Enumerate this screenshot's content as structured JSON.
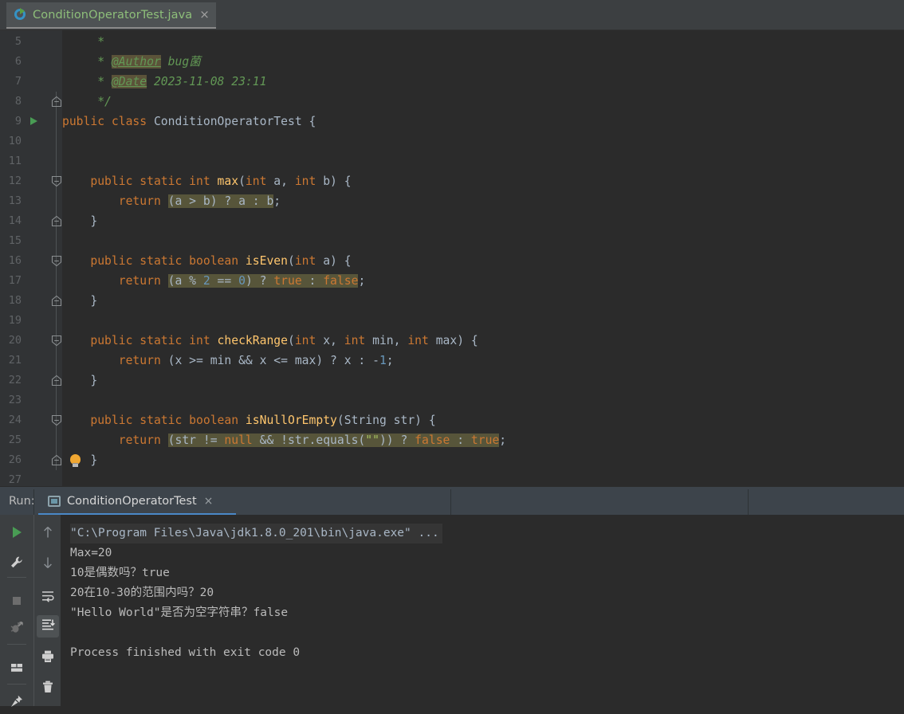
{
  "editor_tab": {
    "title": "ConditionOperatorTest.java",
    "icon": "java-class-runnable-icon",
    "close_label": "×"
  },
  "editor": {
    "first_visible_line": 5,
    "last_visible_line": 27,
    "lines": [
      {
        "n": 5,
        "fold": null,
        "run": false,
        "bulb": false,
        "tokens": [
          {
            "t": "     *",
            "c": "cmt"
          }
        ]
      },
      {
        "n": 6,
        "fold": null,
        "run": false,
        "bulb": false,
        "tokens": [
          {
            "t": "     * ",
            "c": "cmt"
          },
          {
            "t": "@Author",
            "c": "tagh"
          },
          {
            "t": " bug菌",
            "c": "cmt"
          }
        ]
      },
      {
        "n": 7,
        "fold": null,
        "run": false,
        "bulb": false,
        "tokens": [
          {
            "t": "     * ",
            "c": "cmt"
          },
          {
            "t": "@Date",
            "c": "tagh"
          },
          {
            "t": " 2023-11-08 23:11",
            "c": "cmt"
          }
        ]
      },
      {
        "n": 8,
        "fold": "end",
        "run": false,
        "bulb": false,
        "tokens": [
          {
            "t": "     */",
            "c": "cmt"
          }
        ]
      },
      {
        "n": 9,
        "fold": null,
        "run": true,
        "bulb": false,
        "tokens": [
          {
            "t": "public ",
            "c": "kw"
          },
          {
            "t": "class ",
            "c": "kw"
          },
          {
            "t": "ConditionOperatorTest",
            "c": "plain"
          },
          {
            "t": " {",
            "c": "plain"
          }
        ]
      },
      {
        "n": 10,
        "fold": null,
        "run": false,
        "bulb": false,
        "tokens": []
      },
      {
        "n": 11,
        "fold": null,
        "run": false,
        "bulb": false,
        "tokens": []
      },
      {
        "n": 12,
        "fold": "start",
        "run": false,
        "bulb": false,
        "tokens": [
          {
            "t": "    ",
            "c": "plain"
          },
          {
            "t": "public static int ",
            "c": "kw"
          },
          {
            "t": "max",
            "c": "meth"
          },
          {
            "t": "(",
            "c": "plain"
          },
          {
            "t": "int ",
            "c": "kw"
          },
          {
            "t": "a, ",
            "c": "plain"
          },
          {
            "t": "int ",
            "c": "kw"
          },
          {
            "t": "b) {",
            "c": "plain"
          }
        ]
      },
      {
        "n": 13,
        "fold": "bar",
        "run": false,
        "bulb": false,
        "tokens": [
          {
            "t": "        ",
            "c": "plain"
          },
          {
            "t": "return ",
            "c": "kw"
          },
          {
            "t": "(a > b) ? a : b",
            "c": "plain",
            "hl": true
          },
          {
            "t": ";",
            "c": "plain"
          }
        ]
      },
      {
        "n": 14,
        "fold": "end",
        "run": false,
        "bulb": false,
        "tokens": [
          {
            "t": "    }",
            "c": "plain"
          }
        ]
      },
      {
        "n": 15,
        "fold": null,
        "run": false,
        "bulb": false,
        "tokens": []
      },
      {
        "n": 16,
        "fold": "start",
        "run": false,
        "bulb": false,
        "tokens": [
          {
            "t": "    ",
            "c": "plain"
          },
          {
            "t": "public static boolean ",
            "c": "kw"
          },
          {
            "t": "isEven",
            "c": "meth"
          },
          {
            "t": "(",
            "c": "plain"
          },
          {
            "t": "int ",
            "c": "kw"
          },
          {
            "t": "a) {",
            "c": "plain"
          }
        ]
      },
      {
        "n": 17,
        "fold": "bar",
        "run": false,
        "bulb": false,
        "tokens": [
          {
            "t": "        ",
            "c": "plain"
          },
          {
            "t": "return ",
            "c": "kw"
          },
          {
            "t": "(a % ",
            "c": "plain",
            "hl": true
          },
          {
            "t": "2",
            "c": "num",
            "hl": true
          },
          {
            "t": " == ",
            "c": "plain",
            "hl": true
          },
          {
            "t": "0",
            "c": "num",
            "hl": true
          },
          {
            "t": ") ? ",
            "c": "plain",
            "hl": true
          },
          {
            "t": "true",
            "c": "kw",
            "hl": true
          },
          {
            "t": " : ",
            "c": "plain",
            "hl": true
          },
          {
            "t": "false",
            "c": "kw",
            "hl": true
          },
          {
            "t": ";",
            "c": "plain"
          }
        ]
      },
      {
        "n": 18,
        "fold": "end",
        "run": false,
        "bulb": false,
        "tokens": [
          {
            "t": "    }",
            "c": "plain"
          }
        ]
      },
      {
        "n": 19,
        "fold": null,
        "run": false,
        "bulb": false,
        "tokens": []
      },
      {
        "n": 20,
        "fold": "start",
        "run": false,
        "bulb": false,
        "tokens": [
          {
            "t": "    ",
            "c": "plain"
          },
          {
            "t": "public static int ",
            "c": "kw"
          },
          {
            "t": "checkRange",
            "c": "meth"
          },
          {
            "t": "(",
            "c": "plain"
          },
          {
            "t": "int ",
            "c": "kw"
          },
          {
            "t": "x, ",
            "c": "plain"
          },
          {
            "t": "int ",
            "c": "kw"
          },
          {
            "t": "min, ",
            "c": "plain"
          },
          {
            "t": "int ",
            "c": "kw"
          },
          {
            "t": "max) {",
            "c": "plain"
          }
        ]
      },
      {
        "n": 21,
        "fold": "bar",
        "run": false,
        "bulb": false,
        "tokens": [
          {
            "t": "        ",
            "c": "plain"
          },
          {
            "t": "return ",
            "c": "kw"
          },
          {
            "t": "(x >= min && x <= max) ? x : -",
            "c": "plain"
          },
          {
            "t": "1",
            "c": "num"
          },
          {
            "t": ";",
            "c": "plain"
          }
        ]
      },
      {
        "n": 22,
        "fold": "end",
        "run": false,
        "bulb": false,
        "tokens": [
          {
            "t": "    }",
            "c": "plain"
          }
        ]
      },
      {
        "n": 23,
        "fold": null,
        "run": false,
        "bulb": false,
        "tokens": []
      },
      {
        "n": 24,
        "fold": "start",
        "run": false,
        "bulb": false,
        "tokens": [
          {
            "t": "    ",
            "c": "plain"
          },
          {
            "t": "public static boolean ",
            "c": "kw"
          },
          {
            "t": "isNullOrEmpty",
            "c": "meth"
          },
          {
            "t": "(String str) {",
            "c": "plain"
          }
        ]
      },
      {
        "n": 25,
        "fold": "bar",
        "run": false,
        "bulb": false,
        "tokens": [
          {
            "t": "        ",
            "c": "plain"
          },
          {
            "t": "return ",
            "c": "kw"
          },
          {
            "t": "(str != ",
            "c": "plain",
            "hl": true
          },
          {
            "t": "null",
            "c": "kw",
            "hl": true
          },
          {
            "t": " && !str.equals(",
            "c": "plain",
            "hl": true
          },
          {
            "t": "\"\"",
            "c": "str",
            "hl": true
          },
          {
            "t": ")) ? ",
            "c": "plain",
            "hl": true
          },
          {
            "t": "false",
            "c": "kw",
            "hl": true
          },
          {
            "t": " : ",
            "c": "plain",
            "hl": true
          },
          {
            "t": "true",
            "c": "kw",
            "hl": true
          },
          {
            "t": ";",
            "c": "plain"
          }
        ]
      },
      {
        "n": 26,
        "fold": "end",
        "run": false,
        "bulb": true,
        "tokens": [
          {
            "t": "    }",
            "c": "plain"
          }
        ]
      },
      {
        "n": 27,
        "fold": null,
        "run": false,
        "bulb": false,
        "tokens": []
      }
    ]
  },
  "run_window": {
    "label": "Run:",
    "tab": {
      "title": "ConditionOperatorTest",
      "icon": "run-configuration-icon",
      "close_label": "×"
    },
    "toolbar_left": [
      {
        "name": "rerun-button",
        "icon": "play-icon",
        "active": false
      },
      {
        "name": "edit-configurations-button",
        "icon": "wrench-icon",
        "active": false
      },
      {
        "name": "stop-button",
        "icon": "stop-square-icon",
        "active": false
      },
      {
        "name": "rerun-failed-button",
        "icon": "bug-rerun-icon",
        "active": false
      },
      {
        "name": "layout-settings-button",
        "icon": "layout-icon",
        "active": false
      },
      {
        "name": "pin-tab-button",
        "icon": "pin-icon",
        "active": false
      }
    ],
    "toolbar_right": [
      {
        "name": "up-the-stack-trace-button",
        "icon": "arrow-up-icon",
        "active": false
      },
      {
        "name": "down-the-stack-trace-button",
        "icon": "arrow-down-icon",
        "active": false
      },
      {
        "name": "soft-wrap-button",
        "icon": "soft-wrap-icon",
        "active": false
      },
      {
        "name": "scroll-to-end-button",
        "icon": "scroll-to-end-icon",
        "active": true
      },
      {
        "name": "print-button",
        "icon": "printer-icon",
        "active": false
      },
      {
        "name": "clear-all-button",
        "icon": "trash-icon",
        "active": false
      }
    ],
    "console_lines": [
      {
        "text": "\"C:\\Program Files\\Java\\jdk1.8.0_201\\bin\\java.exe\" ...",
        "cmd": true
      },
      {
        "text": "Max=20",
        "cmd": false
      },
      {
        "text": "10是偶数吗？true",
        "cmd": false
      },
      {
        "text": "20在10-30的范围内吗？20",
        "cmd": false
      },
      {
        "text": "\"Hello World\"是否为空字符串？false",
        "cmd": false
      },
      {
        "text": "",
        "cmd": false
      },
      {
        "text": "Process finished with exit code 0",
        "cmd": false
      }
    ]
  },
  "colors": {
    "editor_bg": "#2b2b2b",
    "gutter_bg": "#313335",
    "panel_bg": "#3c3f41",
    "tab_active_bg": "#4e5254",
    "run_tabbar_bg": "#3d444b",
    "accent_blue": "#4a88c7",
    "keyword": "#cc7832",
    "method": "#ffc66d",
    "number": "#6897bb",
    "string": "#a5c261",
    "comment": "#629755",
    "text": "#a9b7c6",
    "highlight": "#57553a",
    "run_green": "#499c54"
  }
}
